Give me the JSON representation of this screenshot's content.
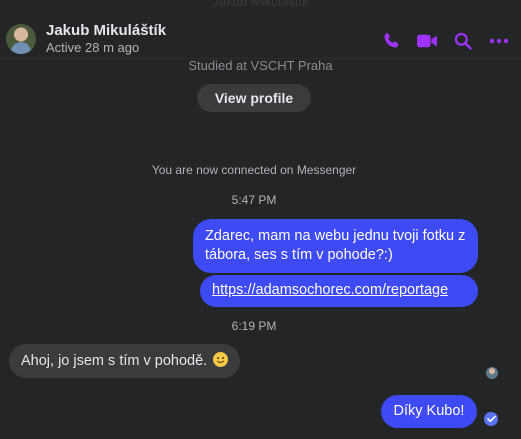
{
  "header": {
    "ghost_text": "Jakub Mikuláštík",
    "contact_name": "Jakub Mikuláštík",
    "status": "Active 28 m ago",
    "icons": [
      "phone-icon",
      "video-camera-icon",
      "search-icon",
      "more-options-icon"
    ],
    "accent_color": "#a033ff"
  },
  "profile": {
    "studied": "Studied at VSCHT Praha",
    "view_profile_label": "View profile"
  },
  "conversation": {
    "connected_notice": "You are now connected on Messenger",
    "time_1": "5:47 PM",
    "msg_out_1": "Zdarec, mam na webu jednu tvoji fotku z tábora, ses s tím v pohode?:)",
    "msg_out_link": "https://adamsochorec.com/reportage",
    "time_2": "6:19 PM",
    "msg_in_1": "Ahoj, jo jsem s tím v pohodě.",
    "msg_in_1_emoji": "smiling-face-emoji",
    "msg_out_2": "Díky Kubo!",
    "outgoing_color": "#3e4af3",
    "incoming_color": "#3a3b3c"
  }
}
